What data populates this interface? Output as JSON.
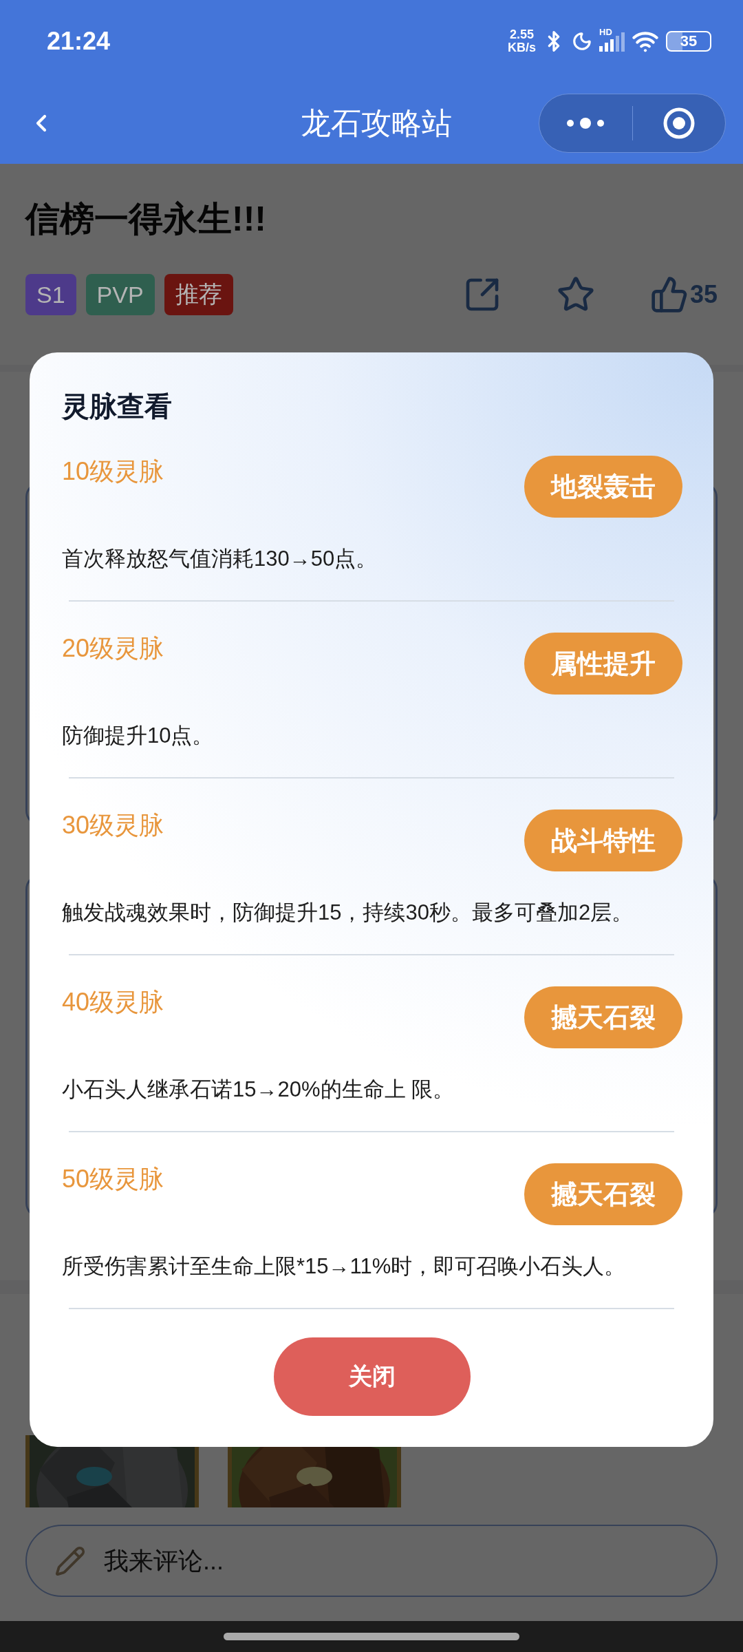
{
  "status_bar": {
    "time": "21:24",
    "speed_value": "2.55",
    "speed_unit": "KB/s",
    "network": "HD",
    "battery": "35"
  },
  "nav": {
    "title": "龙石攻略站"
  },
  "article": {
    "title": "信榜一得永生!!!",
    "tags": [
      {
        "label": "S1",
        "color": "#4d3a8a"
      },
      {
        "label": "PVP",
        "color": "#2f5f4f"
      },
      {
        "label": "推荐",
        "color": "#6a1410"
      }
    ],
    "likes": "35"
  },
  "modal": {
    "title": "灵脉查看",
    "entries": [
      {
        "level": "10级灵脉",
        "skill": "地裂轰击",
        "description": "首次释放怒气值消耗130→50点。"
      },
      {
        "level": "20级灵脉",
        "skill": "属性提升",
        "description": "防御提升10点。"
      },
      {
        "level": "30级灵脉",
        "skill": "战斗特性",
        "description": "触发战魂效果时，防御提升15，持续30秒。最多可叠加2层。"
      },
      {
        "level": "40级灵脉",
        "skill": "撼天石裂",
        "description": "小石头人继承石诺15→20%的生命上 限。"
      },
      {
        "level": "50级灵脉",
        "skill": "撼天石裂",
        "description": "所受伤害累计至生命上限*15→11%时，即可召唤小石头人。"
      }
    ],
    "close": "关闭"
  },
  "comment": {
    "placeholder": "我来评论..."
  }
}
